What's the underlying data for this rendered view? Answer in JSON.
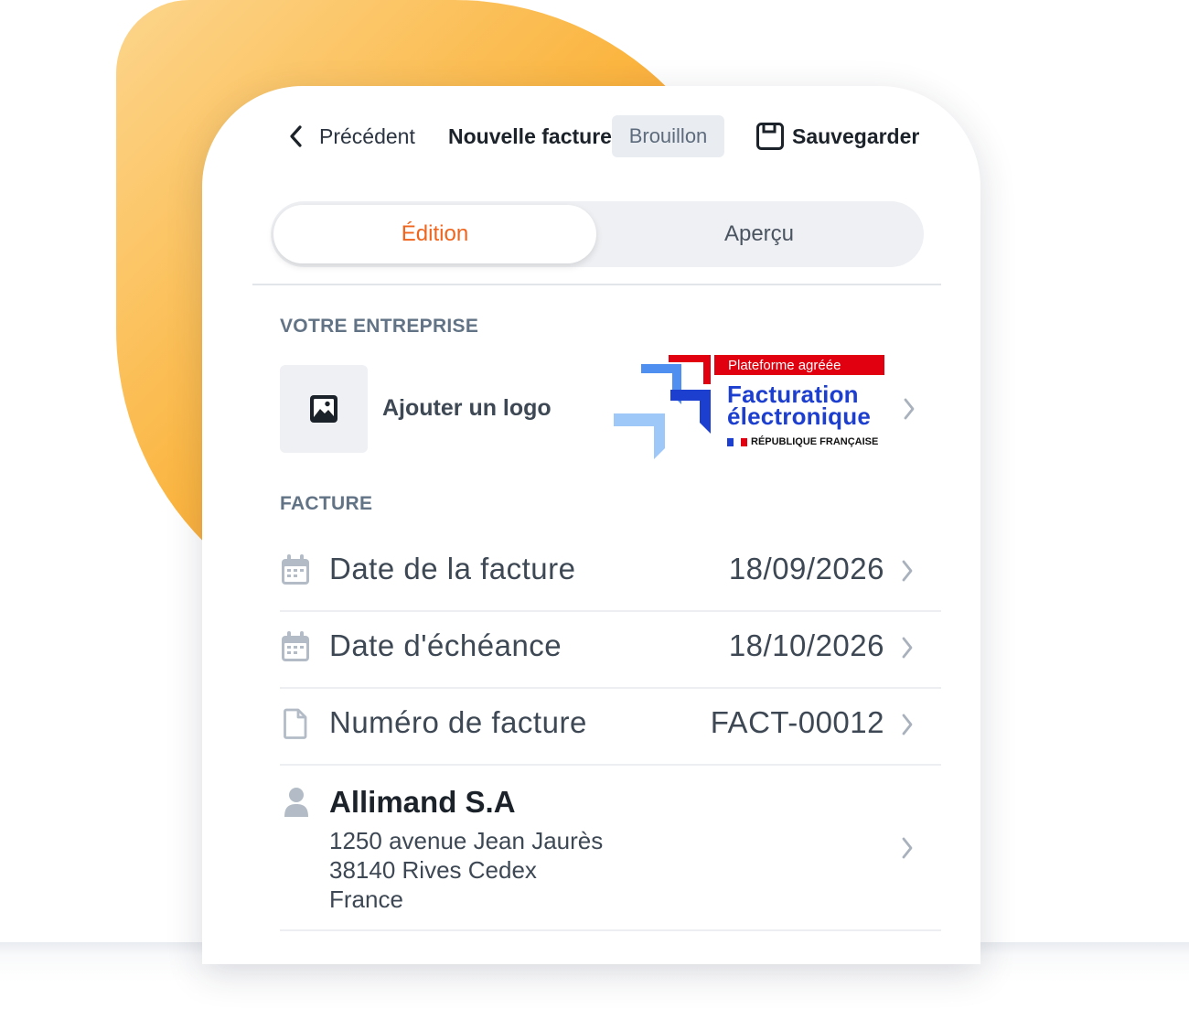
{
  "header": {
    "back_label": "Précédent",
    "title": "Nouvelle facture",
    "status_badge": "Brouillon",
    "save_label": "Sauvegarder"
  },
  "tabs": [
    {
      "label": "Édition",
      "active": true
    },
    {
      "label": "Aperçu",
      "active": false
    }
  ],
  "company_section": {
    "title": "VOTRE ENTREPRISE",
    "add_logo_label": "Ajouter un logo",
    "certification": {
      "ribbon": "Plateforme agréée",
      "line1": "Facturation",
      "line2": "électronique",
      "republic": "RÉPUBLIQUE FRANÇAISE"
    }
  },
  "invoice_section": {
    "title": "FACTURE",
    "rows": [
      {
        "label": "Date de la facture",
        "value": "18/09/2026",
        "icon": "calendar-icon"
      },
      {
        "label": "Date d'échéance",
        "value": "18/10/2026",
        "icon": "calendar-icon"
      },
      {
        "label": "Numéro de facture",
        "value": "FACT-00012",
        "icon": "document-icon"
      }
    ],
    "client": {
      "name": "Allimand S.A",
      "address_line1": "1250 avenue Jean Jaurès",
      "address_line2": "38140 Rives Cedex",
      "country": "France",
      "icon": "person-icon"
    }
  },
  "colors": {
    "accent": "#f0641c",
    "section_title": "#627386",
    "badge_bg": "#e9edf2",
    "marianne_blue": "#1d3fcf",
    "marianne_red": "#e1000f"
  }
}
